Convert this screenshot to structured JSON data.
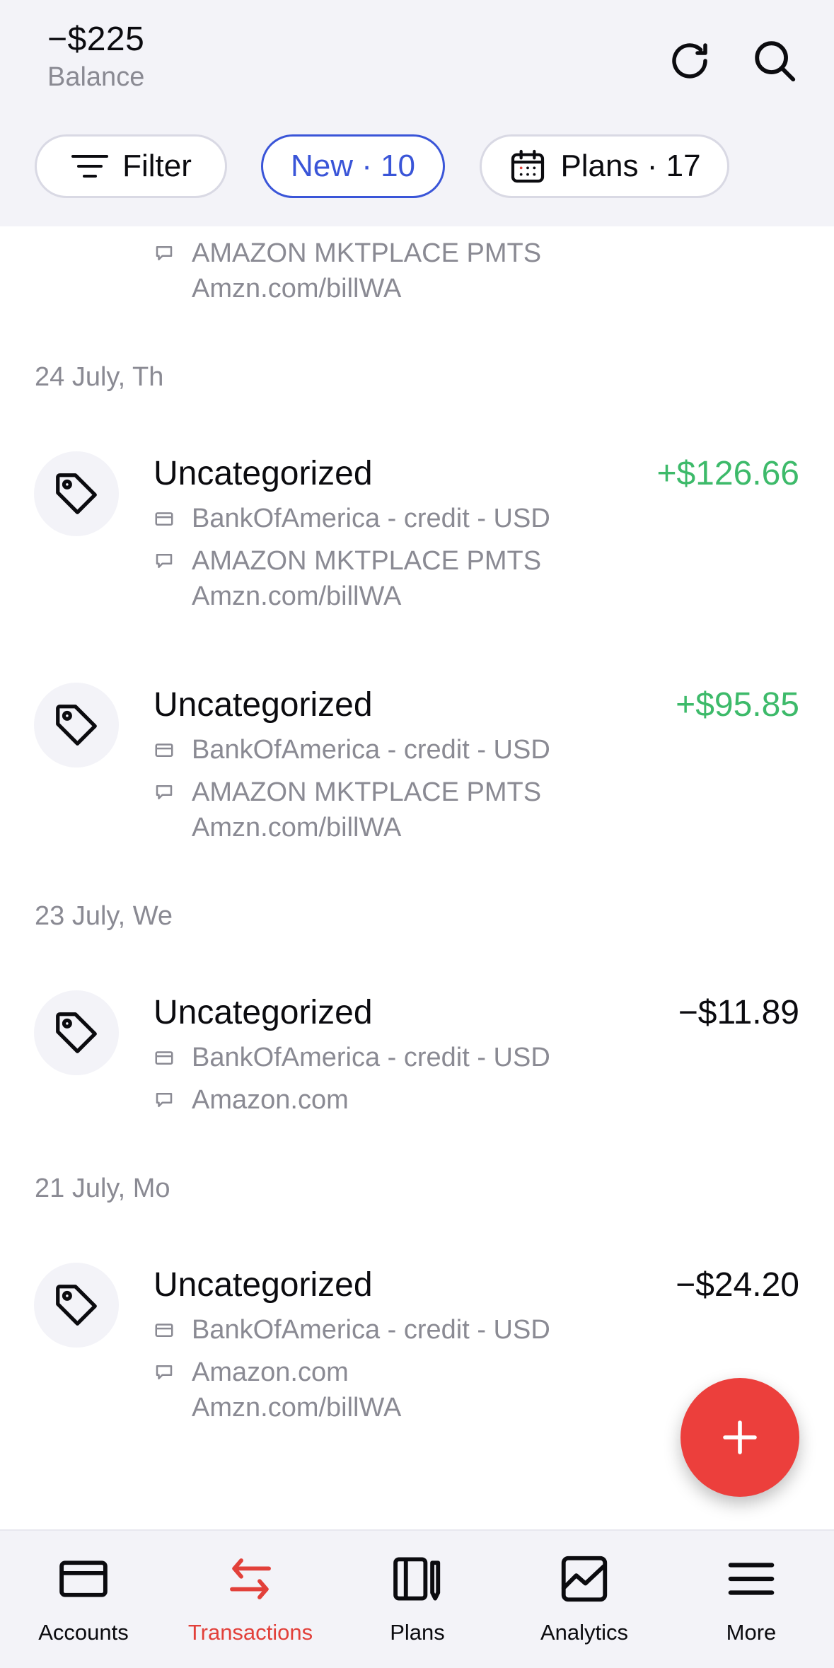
{
  "header": {
    "balance": "−$225",
    "balance_label": "Balance",
    "chips": {
      "filter": "Filter",
      "new": "New · 10",
      "plans": "Plans · 17"
    },
    "icons": {
      "refresh": "refresh-icon",
      "search": "search-icon"
    }
  },
  "partial": {
    "note_line1": "AMAZON MKTPLACE PMTS",
    "note_line2": "Amzn.com/billWA"
  },
  "groups": [
    {
      "date": "24 July, Th",
      "items": [
        {
          "category": "Uncategorized",
          "amount": "+$126.66",
          "account": "BankOfAmerica - credit - USD",
          "note1": "AMAZON MKTPLACE PMTS",
          "note2": "Amzn.com/billWA"
        },
        {
          "category": "Uncategorized",
          "amount": "+$95.85",
          "account": "BankOfAmerica - credit - USD",
          "note1": "AMAZON MKTPLACE PMTS",
          "note2": "Amzn.com/billWA"
        }
      ]
    },
    {
      "date": "23 July, We",
      "items": [
        {
          "category": "Uncategorized",
          "amount": "−$11.89",
          "account": "BankOfAmerica - credit - USD",
          "note1": "Amazon.com"
        }
      ]
    },
    {
      "date": "21 July, Mo",
      "items": [
        {
          "category": "Uncategorized",
          "amount": "−$24.20",
          "account": "BankOfAmerica - credit - USD",
          "note1": "Amazon.com",
          "note2": "Amzn.com/billWA"
        }
      ]
    }
  ],
  "tabbar": {
    "tabs": [
      {
        "label": "Accounts"
      },
      {
        "label": "Transactions"
      },
      {
        "label": "Plans"
      },
      {
        "label": "Analytics"
      },
      {
        "label": "More"
      }
    ],
    "active_color": "#e2403a"
  },
  "colors": {
    "positive": "#3dba6a",
    "accent": "#3a55d8",
    "fab": "#ec3f3c"
  }
}
